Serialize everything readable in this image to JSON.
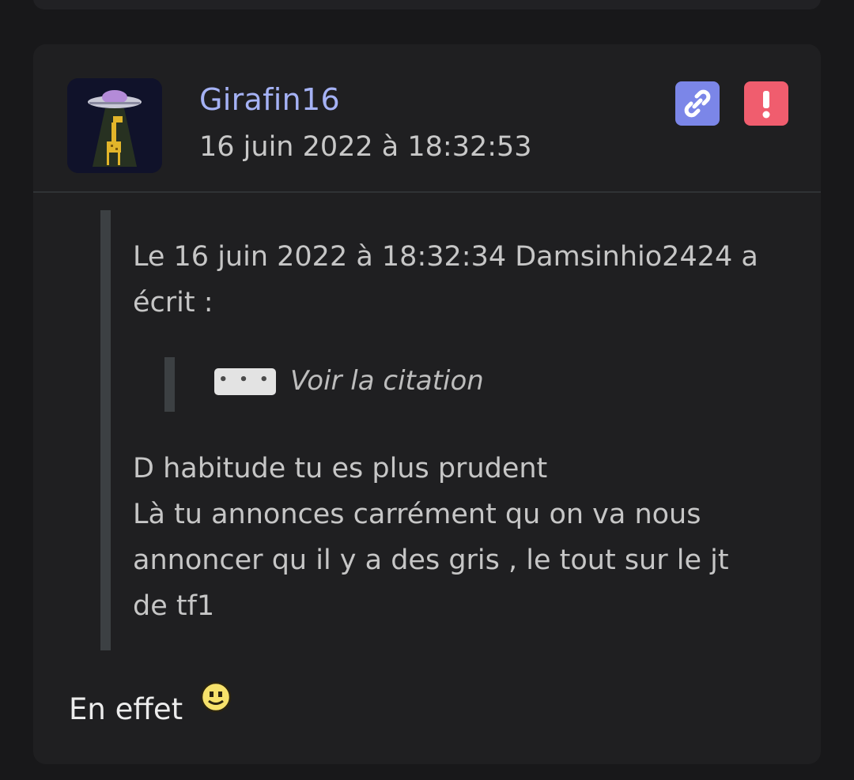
{
  "post": {
    "username": "Girafin16",
    "date": "16 juin 2022 à 18:32:53",
    "avatar_icon": "ufo-giraffe-avatar",
    "actions": [
      {
        "name": "link-button",
        "icon": "link-icon",
        "color": "#7b86e8"
      },
      {
        "name": "report-button",
        "icon": "exclamation-icon",
        "color": "#f05d6e"
      }
    ],
    "quote": {
      "header": "Le 16 juin 2022 à 18:32:34 Damsinhio2424 a écrit :",
      "nested_button_label": "• • •",
      "nested_label": "Voir la citation",
      "body_lines": [
        "D habitude tu es plus prudent",
        "Là tu annonces carrément qu on va nous annoncer qu il y a des gris , le tout sur le jt de tf1"
      ]
    },
    "reply_text": "En effet",
    "reply_emoji": "smiley-icon"
  },
  "colors": {
    "background": "#18181a",
    "card": "#1f1f21",
    "username": "#a5b2f5",
    "quote_bar": "#3c4043"
  }
}
